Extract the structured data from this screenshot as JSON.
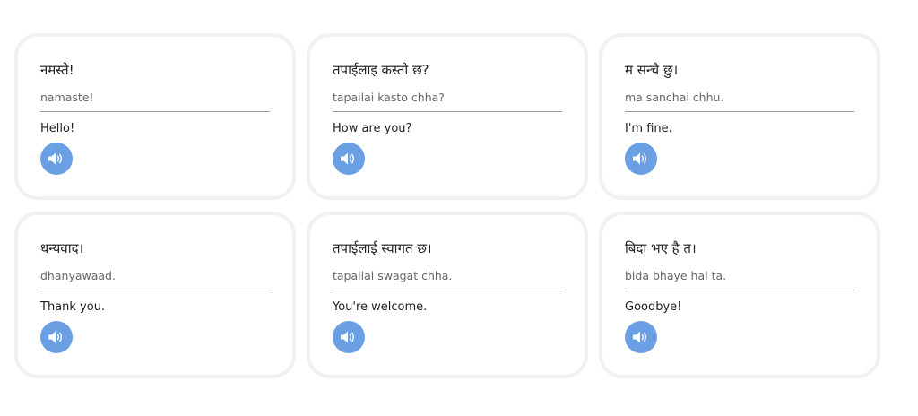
{
  "accent_color": "#6b9fe4",
  "cards": [
    {
      "native": "नमस्ते!",
      "roman": "namaste!",
      "english": "Hello!",
      "icon": "speaker-icon"
    },
    {
      "native": "तपाईलाइ कस्तो छ?",
      "roman": "tapailai kasto chha?",
      "english": "How are you?",
      "icon": "speaker-icon"
    },
    {
      "native": "म सन्चै छु।",
      "roman": "ma sanchai chhu.",
      "english": "I'm fine.",
      "icon": "speaker-icon"
    },
    {
      "native": "धन्यवाद।",
      "roman": "dhanyawaad.",
      "english": "Thank you.",
      "icon": "speaker-icon"
    },
    {
      "native": "तपाईलाई स्वागत छ।",
      "roman": "tapailai swagat chha.",
      "english": "You're welcome.",
      "icon": "speaker-icon"
    },
    {
      "native": "बिदा भए है त।",
      "roman": "bida bhaye hai ta.",
      "english": "Goodbye!",
      "icon": "speaker-icon"
    }
  ]
}
